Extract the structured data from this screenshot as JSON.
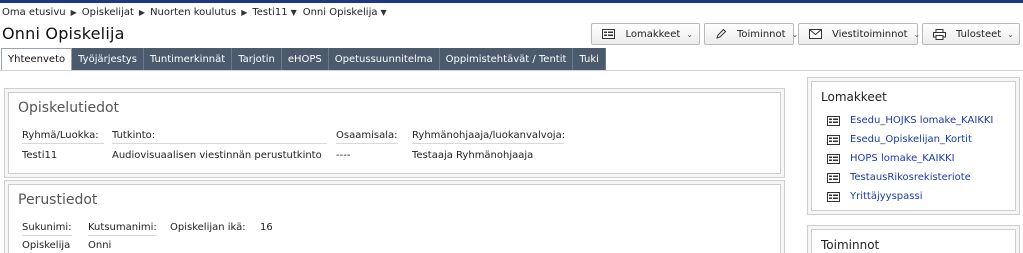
{
  "breadcrumb": [
    {
      "label": "Oma etusivu"
    },
    {
      "label": "Opiskelijat"
    },
    {
      "label": "Nuorten koulutus"
    },
    {
      "label": "Testi11"
    },
    {
      "label": "Onni Opiskelija"
    }
  ],
  "student_name": "Onni Opiskelija",
  "actions": [
    {
      "label": "Lomakkeet",
      "icon": "form-icon"
    },
    {
      "label": "Toiminnot",
      "icon": "pencil-icon"
    },
    {
      "label": "Viestitoiminnot",
      "icon": "envelope-icon"
    },
    {
      "label": "Tulosteet",
      "icon": "printer-icon"
    }
  ],
  "tabs": [
    {
      "label": "Yhteenveto",
      "active": true
    },
    {
      "label": "Työjärjestys"
    },
    {
      "label": "Tuntimerkinnät"
    },
    {
      "label": "Tarjotin"
    },
    {
      "label": "eHOPS"
    },
    {
      "label": "Opetussuunnitelma"
    },
    {
      "label": "Oppimistehtävät / Tentit"
    },
    {
      "label": "Tuki"
    }
  ],
  "opiskelutiedot": {
    "title": "Opiskelutiedot",
    "headers": [
      "Ryhmä/Luokka:",
      "Tutkinto:",
      "Osaamisala:",
      "Ryhmänohjaaja/luokanvalvoja:"
    ],
    "values": [
      "Testi11",
      "Audiovisuaalisen viestinnän perustutkinto",
      "----",
      "Testaaja Ryhmänohjaaja"
    ]
  },
  "perustiedot": {
    "title": "Perustiedot",
    "headers": [
      "Sukunimi:",
      "Kutsumanimi:",
      "Opiskelijan ikä:"
    ],
    "age": "16",
    "values": [
      "Opiskelija",
      "Onni"
    ]
  },
  "lomakkeet_panel": {
    "title": "Lomakkeet",
    "items": [
      "Esedu_HOJKS lomake_KAIKKI",
      "Esedu_Opiskelijan_Kortit",
      "HOPS lomake_KAIKKI",
      "TestausRikosrekisteriote",
      "Yrittäjyyspassi"
    ]
  },
  "toiminnot_panel": {
    "title": "Toiminnot"
  }
}
